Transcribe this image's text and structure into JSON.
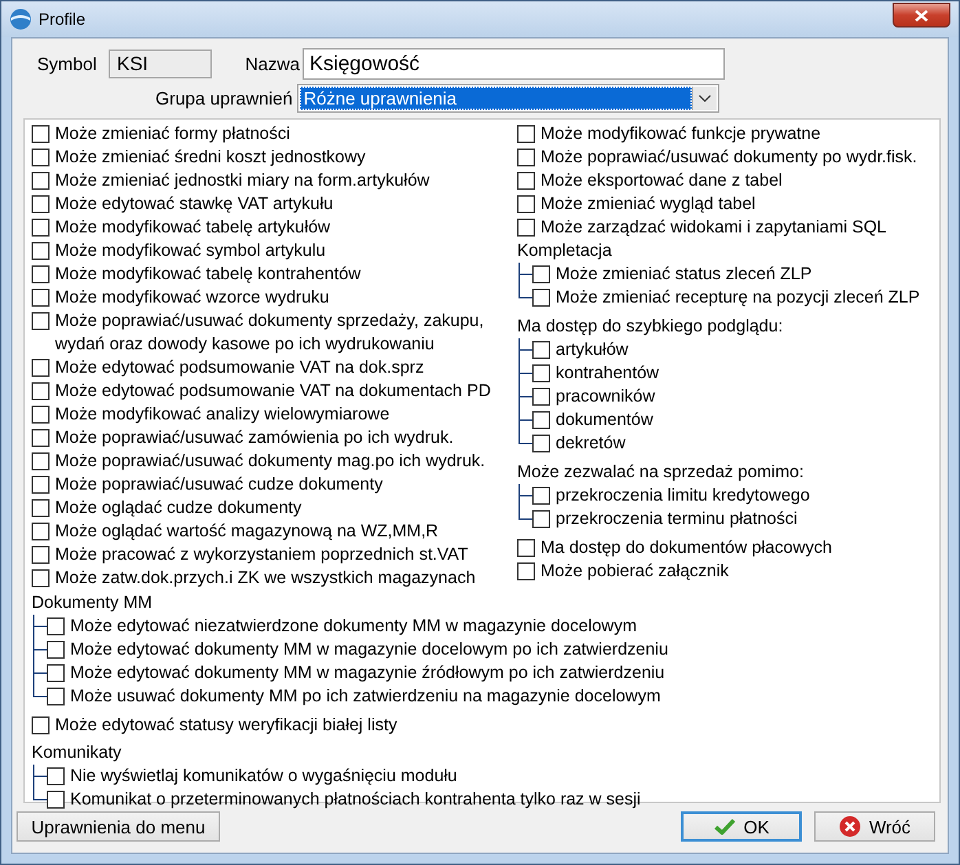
{
  "window": {
    "title": "Profile"
  },
  "symbol": {
    "label": "Symbol",
    "value": "KSI"
  },
  "name": {
    "label": "Nazwa",
    "value": "Księgowość"
  },
  "group": {
    "label": "Grupa uprawnień",
    "value": "Różne uprawnienia"
  },
  "left_column": [
    {
      "kind": "checkbox",
      "label": "Może zmieniać formy płatności",
      "checked": false
    },
    {
      "kind": "checkbox",
      "label": "Może zmieniać średni koszt jednostkowy",
      "checked": false
    },
    {
      "kind": "checkbox",
      "label": "Może zmieniać jednostki miary na form.artykułów",
      "checked": false
    },
    {
      "kind": "checkbox",
      "label": "Może edytować stawkę VAT artykułu",
      "checked": false
    },
    {
      "kind": "checkbox",
      "label": "Może modyfikować tabelę artykułów",
      "checked": false
    },
    {
      "kind": "checkbox",
      "label": "Może modyfikować symbol artykulu",
      "checked": false
    },
    {
      "kind": "checkbox",
      "label": "Może modyfikować tabelę kontrahentów",
      "checked": false
    },
    {
      "kind": "checkbox",
      "label": "Może modyfikować wzorce wydruku",
      "checked": false
    },
    {
      "kind": "checkbox",
      "label": "Może poprawiać/usuwać dokumenty sprzedaży, zakupu, wydań oraz dowody kasowe po ich wydrukowaniu",
      "checked": false
    },
    {
      "kind": "checkbox",
      "label": "Może edytować podsumowanie VAT na dok.sprz",
      "checked": false
    },
    {
      "kind": "checkbox",
      "label": "Może edytować podsumowanie VAT na dokumentach PD",
      "checked": false
    },
    {
      "kind": "checkbox",
      "label": "Może modyfikować analizy wielowymiarowe",
      "checked": false
    },
    {
      "kind": "checkbox",
      "label": "Może poprawiać/usuwać zamówienia po ich wydruk.",
      "checked": false
    },
    {
      "kind": "checkbox",
      "label": "Może poprawiać/usuwać dokumenty mag.po ich wydruk.",
      "checked": false
    },
    {
      "kind": "checkbox",
      "label": "Może poprawiać/usuwać cudze dokumenty",
      "checked": false
    },
    {
      "kind": "checkbox",
      "label": "Może oglądać cudze dokumenty",
      "checked": false
    },
    {
      "kind": "checkbox",
      "label": "Może oglądać wartość magazynową na WZ,MM,R",
      "checked": false
    },
    {
      "kind": "checkbox",
      "label": "Może pracować z wykorzystaniem poprzednich st.VAT",
      "checked": false
    },
    {
      "kind": "checkbox",
      "label": "Może zatw.dok.przych.i ZK we wszystkich magazynach",
      "checked": false
    }
  ],
  "right_column": [
    {
      "kind": "checkbox",
      "label": "Może modyfikować funkcje prywatne",
      "checked": false
    },
    {
      "kind": "checkbox",
      "label": "Może poprawiać/usuwać dokumenty po wydr.fisk.",
      "checked": false
    },
    {
      "kind": "checkbox",
      "label": "Może eksportować dane z tabel",
      "checked": false
    },
    {
      "kind": "checkbox",
      "label": "Może zmieniać wygląd tabel",
      "checked": false
    },
    {
      "kind": "checkbox",
      "label": "Może zarządzać widokami i zapytaniami SQL",
      "checked": false
    },
    {
      "kind": "group",
      "title": "Kompletacja",
      "children": [
        {
          "label": "Może zmieniać status zleceń ZLP",
          "checked": false
        },
        {
          "label": "Może zmieniać recepturę na pozycji zleceń ZLP",
          "checked": false
        }
      ]
    },
    {
      "kind": "group",
      "title": "Ma dostęp do szybkiego podglądu:",
      "children": [
        {
          "label": "artykułów",
          "checked": false
        },
        {
          "label": "kontrahentów",
          "checked": false
        },
        {
          "label": "pracowników",
          "checked": false
        },
        {
          "label": "dokumentów",
          "checked": false
        },
        {
          "label": "dekretów",
          "checked": false
        }
      ]
    },
    {
      "kind": "group",
      "title": "Może zezwalać na sprzedaż pomimo:",
      "children": [
        {
          "label": "przekroczenia limitu kredytowego",
          "checked": false
        },
        {
          "label": "przekroczenia terminu płatności",
          "checked": false
        }
      ]
    },
    {
      "kind": "checkbox",
      "label": "Ma dostęp do dokumentów płacowych",
      "checked": false
    },
    {
      "kind": "checkbox",
      "label": "Może pobierać załącznik",
      "checked": false
    }
  ],
  "bottom_section": [
    {
      "kind": "group",
      "title": "Dokumenty MM",
      "children": [
        {
          "label": "Może edytować niezatwierdzone dokumenty MM w magazynie docelowym",
          "checked": false
        },
        {
          "label": "Może edytować dokumenty MM w magazynie docelowym po ich zatwierdzeniu",
          "checked": false
        },
        {
          "label": "Może edytować dokumenty MM w magazynie źródłowym po ich zatwierdzeniu",
          "checked": false
        },
        {
          "label": "Może usuwać dokumenty MM po ich zatwierdzeniu na magazynie docelowym",
          "checked": false
        }
      ]
    },
    {
      "kind": "checkbox",
      "label": "Może edytować statusy weryfikacji białej listy",
      "checked": false
    },
    {
      "kind": "group",
      "title": "Komunikaty",
      "children": [
        {
          "label": "Nie wyświetlaj komunikatów o wygaśnięciu modułu",
          "checked": false
        },
        {
          "label": "Komunikat o przeterminowanych płatnościach kontrahenta tylko raz w sesji",
          "checked": false
        }
      ]
    }
  ],
  "buttons": [
    {
      "kind": "menu",
      "label": "Uprawnienia do menu",
      "default": false
    },
    {
      "kind": "ok",
      "label": "OK",
      "default": true
    },
    {
      "kind": "cancel",
      "label": "Wróć",
      "default": false
    }
  ]
}
